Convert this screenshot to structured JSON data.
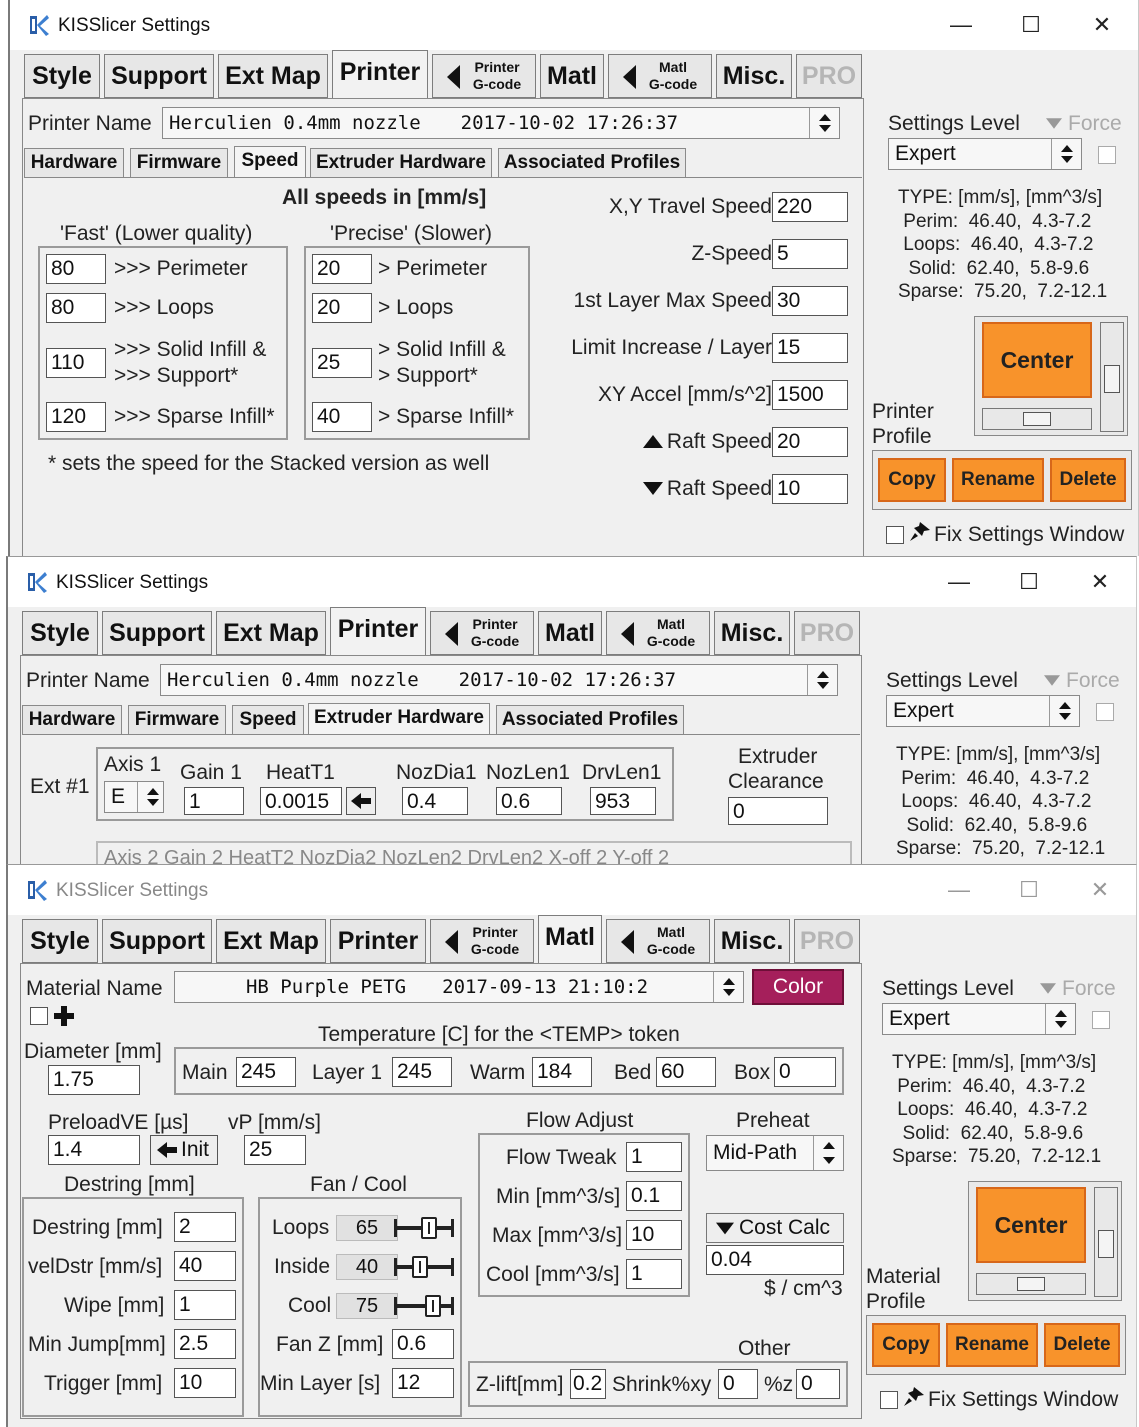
{
  "windows": {
    "title": "KISSlicer Settings",
    "controls": {
      "minimize": "—",
      "maximize": "☐",
      "close": "✕"
    }
  },
  "tabs": {
    "style": "Style",
    "support": "Support",
    "extmap": "Ext Map",
    "printer": "Printer",
    "printer_gcode_1": "Printer",
    "printer_gcode_2": "G-code",
    "matl": "Matl",
    "matl_gcode_1": "Matl",
    "matl_gcode_2": "G-code",
    "misc": "Misc.",
    "pro": "PRO"
  },
  "subtabs": {
    "hardware": "Hardware",
    "firmware": "Firmware",
    "speed": "Speed",
    "extruder_hardware": "Extruder Hardware",
    "associated_profiles": "Associated Profiles"
  },
  "printer": {
    "name_label": "Printer Name",
    "name_value": "Herculien 0.4mm nozzle",
    "name_date": "2017-10-02 17:26:37"
  },
  "sidepanel": {
    "settings_level_label": "Settings Level",
    "force_label": "Force",
    "level_value": "Expert",
    "type_info": [
      "TYPE: [mm/s], [mm^3/s]",
      " Perim:  46.40,  4.3-7.2",
      " Loops:  46.40,  4.3-7.2",
      "  Solid:  62.40,  5.8-9.6",
      "Sparse:  75.20,  7.2-12.1"
    ],
    "center_button": "Center",
    "printer_profile_1": "Printer",
    "printer_profile_2": "Profile",
    "material_profile_1": "Material",
    "material_profile_2": "Profile",
    "copy": "Copy",
    "rename": "Rename",
    "delete": "Delete",
    "fix_settings": "Fix Settings Window"
  },
  "speed": {
    "header": "All speeds in [mm/s]",
    "fast_title": "'Fast' (Lower quality)",
    "precise_title": "'Precise' (Slower)",
    "fast": [
      {
        "value": "80",
        "l1": ">>> Perimeter",
        "l2": ""
      },
      {
        "value": "80",
        "l1": ">>> Loops",
        "l2": ""
      },
      {
        "value": "110",
        "l1": ">>> Solid Infill &",
        "l2": ">>> Support*"
      },
      {
        "value": "120",
        "l1": ">>> Sparse Infill*",
        "l2": ""
      }
    ],
    "precise": [
      {
        "value": "20",
        "l1": "> Perimeter",
        "l2": ""
      },
      {
        "value": "20",
        "l1": "> Loops",
        "l2": ""
      },
      {
        "value": "25",
        "l1": "> Solid Infill &",
        "l2": "> Support*"
      },
      {
        "value": "40",
        "l1": "> Sparse Infill*",
        "l2": ""
      }
    ],
    "footnote": "* sets the speed for the Stacked version as well",
    "right_fields": [
      {
        "label": "X,Y Travel Speed",
        "value": "220"
      },
      {
        "label": "Z-Speed",
        "value": "5"
      },
      {
        "label": "1st Layer Max Speed",
        "value": "30"
      },
      {
        "label": "Limit Increase / Layer",
        "value": "15"
      },
      {
        "label": "XY Accel [mm/s^2]",
        "value": "1500"
      },
      {
        "label": "Raft Speed",
        "value": "20"
      },
      {
        "label": "Raft Speed",
        "value": "10"
      }
    ]
  },
  "extruder": {
    "ext_label": "Ext #1",
    "axis_label": "Axis 1",
    "axis_value": "E",
    "gain_label": "Gain 1",
    "gain_value": "1",
    "heat_label": "HeatT1",
    "heat_value": "0.0015",
    "nozdia_label": "NozDia1",
    "nozdia_value": "0.4",
    "nozlen_label": "NozLen1",
    "nozlen_value": "0.6",
    "drvlen_label": "DrvLen1",
    "drvlen_value": "953",
    "clearance_1": "Extruder",
    "clearance_2": "Clearance",
    "clearance_value": "0",
    "row2_partial": "Axis 2    Gain 2     HeatT2              NozDia2  NozLen2  DrvLen2    X-off 2      Y-off 2"
  },
  "material": {
    "name_label": "Material Name",
    "name_value": "HB Purple PETG",
    "name_date": "2017-09-13 21:10:2",
    "color_button": "Color",
    "color_hex": "#a51f5b",
    "diameter_label": "Diameter [mm]",
    "diameter_value": "1.75",
    "temp_title": "Temperature [C] for the <TEMP> token",
    "temps": [
      {
        "label": "Main",
        "value": "245"
      },
      {
        "label": "Layer 1",
        "value": "245"
      },
      {
        "label": "Warm",
        "value": "184"
      },
      {
        "label": "Bed",
        "value": "60"
      },
      {
        "label": "Box",
        "value": "0"
      }
    ],
    "preload_label": "PreloadVE [µs]",
    "preload_value": "1.4",
    "init_button": "Init",
    "vp_label": "vP [mm/s]",
    "vp_value": "25",
    "destring_title": "Destring [mm]",
    "destring": [
      {
        "label": "Destring [mm]",
        "value": "2"
      },
      {
        "label": "velDstr [mm/s]",
        "value": "40"
      },
      {
        "label": "Wipe [mm]",
        "value": "1"
      },
      {
        "label": "Min Jump[mm]",
        "value": "2.5"
      },
      {
        "label": "Trigger [mm]",
        "value": "10"
      }
    ],
    "fan_title": "Fan / Cool",
    "fans": [
      {
        "label": "Loops",
        "value": "65",
        "level": 0.65
      },
      {
        "label": "Inside",
        "value": "40",
        "level": 0.4
      },
      {
        "label": "Cool",
        "value": "75",
        "level": 0.75
      }
    ],
    "fanz_label": "Fan Z [mm]",
    "fanz_value": "0.6",
    "minlayer_label": "Min Layer [s]",
    "minlayer_value": "12",
    "flow_title": "Flow Adjust",
    "flow": [
      {
        "label": "Flow Tweak",
        "value": "1"
      },
      {
        "label": "Min [mm^3/s]",
        "value": "0.1"
      },
      {
        "label": "Max [mm^3/s]",
        "value": "10"
      },
      {
        "label": "Cool [mm^3/s]",
        "value": "1"
      }
    ],
    "preheat_title": "Preheat",
    "preheat_value": "Mid-Path",
    "cost_button": "Cost Calc",
    "cost_value": "0.04",
    "cost_unit": "$ / cm^3",
    "other_title": "Other",
    "zlift_label": "Z-lift[mm]",
    "zlift_value": "0.2",
    "shrinkxy_label": "Shrink%xy",
    "shrinkxy_value": "0",
    "shrinkz_label": "%z",
    "shrinkz_value": "0"
  },
  "colors": {
    "accent_orange": "#f8932b",
    "color_button": "#a51f5b"
  }
}
